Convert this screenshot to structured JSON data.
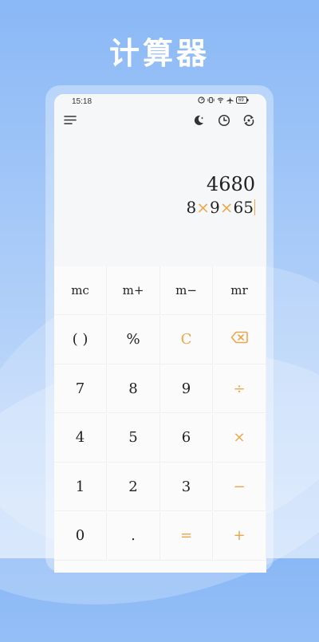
{
  "headline": "计算器",
  "status_bar": {
    "time": "15:18",
    "battery": "69"
  },
  "display": {
    "result": "4680",
    "expression": [
      {
        "t": "8",
        "op": false
      },
      {
        "t": "×",
        "op": true
      },
      {
        "t": "9",
        "op": false
      },
      {
        "t": "×",
        "op": true
      },
      {
        "t": "65",
        "op": false
      }
    ]
  },
  "keys": [
    {
      "id": "mc",
      "label": "mc",
      "kind": "mem"
    },
    {
      "id": "m-plus",
      "label": "m+",
      "kind": "mem"
    },
    {
      "id": "m-minus",
      "label": "m−",
      "kind": "mem"
    },
    {
      "id": "mr",
      "label": "mr",
      "kind": "mem"
    },
    {
      "id": "parentheses",
      "label": "( )",
      "kind": "normal"
    },
    {
      "id": "percent",
      "label": "%",
      "kind": "normal"
    },
    {
      "id": "clear",
      "label": "C",
      "kind": "accent"
    },
    {
      "id": "backspace",
      "label": "",
      "kind": "icon"
    },
    {
      "id": "digit-7",
      "label": "7",
      "kind": "normal"
    },
    {
      "id": "digit-8",
      "label": "8",
      "kind": "normal"
    },
    {
      "id": "digit-9",
      "label": "9",
      "kind": "normal"
    },
    {
      "id": "divide",
      "label": "÷",
      "kind": "accent"
    },
    {
      "id": "digit-4",
      "label": "4",
      "kind": "normal"
    },
    {
      "id": "digit-5",
      "label": "5",
      "kind": "normal"
    },
    {
      "id": "digit-6",
      "label": "6",
      "kind": "normal"
    },
    {
      "id": "multiply",
      "label": "×",
      "kind": "accent"
    },
    {
      "id": "digit-1",
      "label": "1",
      "kind": "normal"
    },
    {
      "id": "digit-2",
      "label": "2",
      "kind": "normal"
    },
    {
      "id": "digit-3",
      "label": "3",
      "kind": "normal"
    },
    {
      "id": "subtract",
      "label": "−",
      "kind": "accent"
    },
    {
      "id": "digit-0",
      "label": "0",
      "kind": "normal"
    },
    {
      "id": "decimal",
      "label": ".",
      "kind": "normal"
    },
    {
      "id": "equals",
      "label": "=",
      "kind": "accent"
    },
    {
      "id": "add",
      "label": "+",
      "kind": "accent"
    }
  ],
  "icons": {
    "menu": "menu-icon",
    "theme": "moon-icon",
    "history": "clock-icon",
    "convert": "rotate-icon",
    "backspace": "backspace-icon"
  },
  "colors": {
    "accent": "#f0a448",
    "background": "#8ab8f6"
  }
}
